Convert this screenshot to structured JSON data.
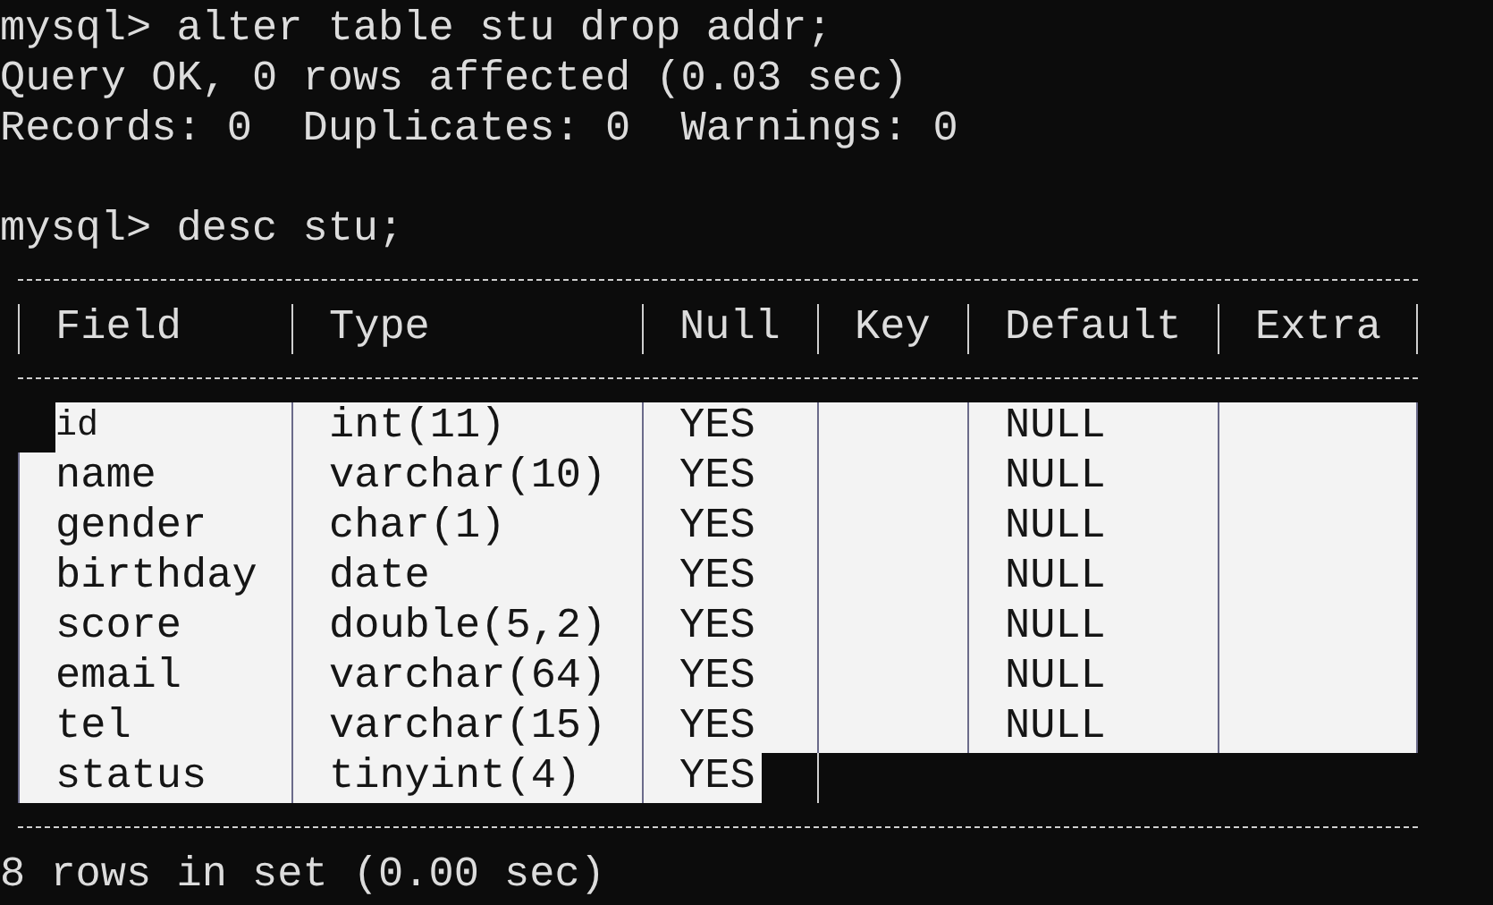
{
  "terminal": {
    "blocks": [
      {
        "lines": [
          "mysql> alter table stu drop addr;",
          "Query OK, 0 rows affected (0.03 sec)",
          "Records: 0  Duplicates: 0  Warnings: 0"
        ]
      },
      {
        "lines": [
          "mysql> desc stu;"
        ]
      }
    ],
    "table": {
      "columns": [
        "Field",
        "Type",
        "Null",
        "Key",
        "Default",
        "Extra"
      ],
      "rows": [
        {
          "field": "id",
          "type": "int(11)",
          "null": "YES",
          "default": "NULL",
          "selected": true
        },
        {
          "field": "name",
          "type": "varchar(10)",
          "null": "YES",
          "default": "NULL",
          "selected": true
        },
        {
          "field": "gender",
          "type": "char(1)",
          "null": "YES",
          "default": "NULL",
          "selected": true
        },
        {
          "field": "birthday",
          "type": "date",
          "null": "YES",
          "default": "NULL",
          "selected": true
        },
        {
          "field": "score",
          "type": "double(5,2)",
          "null": "YES",
          "default": "NULL",
          "selected": true
        },
        {
          "field": "email",
          "type": "varchar(64)",
          "null": "YES",
          "default": "NULL",
          "selected": true
        },
        {
          "field": "tel",
          "type": "varchar(15)",
          "null": "YES",
          "default": "NULL",
          "selected": true
        },
        {
          "field": "status",
          "type": "tinyint(4)",
          "null": "YES",
          "selected": true
        }
      ]
    },
    "after": [
      "8 rows in set (0.00 sec)"
    ]
  }
}
